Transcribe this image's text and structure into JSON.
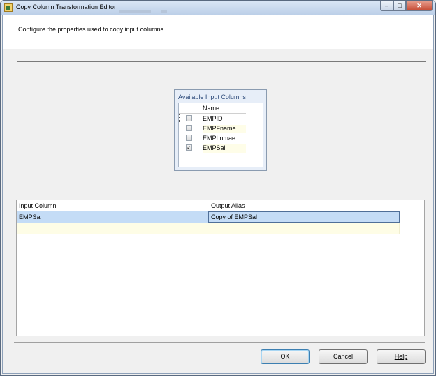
{
  "window": {
    "title": "Copy Column Transformation Editor",
    "controls": {
      "minimize": "–",
      "maximize": "□",
      "close": "✕"
    }
  },
  "description": "Configure the properties used to copy input columns.",
  "available_columns": {
    "title": "Available Input Columns",
    "header": "Name",
    "rows": [
      {
        "name": "EMPID",
        "checked": false,
        "mark": ""
      },
      {
        "name": "EMPFname",
        "checked": false,
        "mark": ""
      },
      {
        "name": "EMPLnmae",
        "checked": false,
        "mark": ""
      },
      {
        "name": "EMPSal",
        "checked": true,
        "mark": "✓"
      }
    ]
  },
  "mapping_grid": {
    "columns": [
      "Input Column",
      "Output Alias"
    ],
    "rows": [
      {
        "input_column": "EMPSal",
        "output_alias": "Copy of EMPSal"
      }
    ]
  },
  "buttons": {
    "ok": "OK",
    "cancel": "Cancel",
    "help": "Help"
  }
}
